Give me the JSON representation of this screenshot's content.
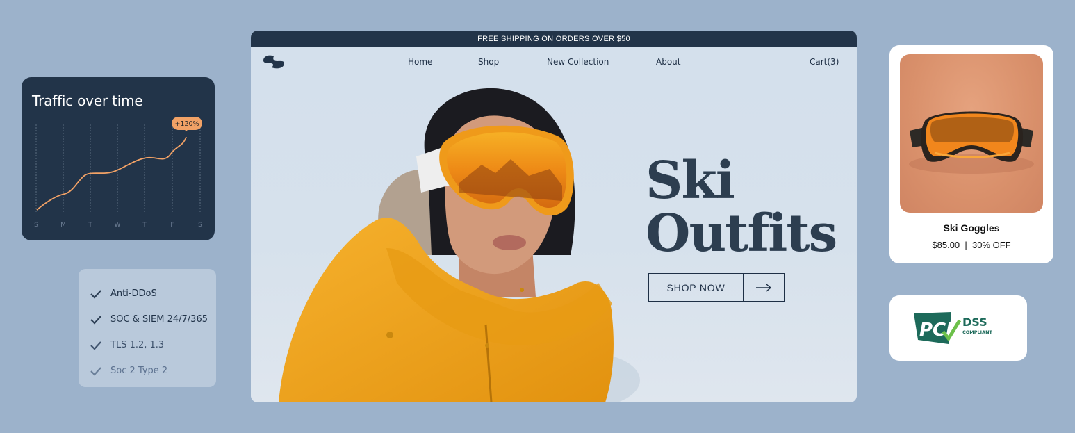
{
  "traffic": {
    "title": "Traffic over time",
    "badge": "+120%",
    "days": [
      "S",
      "M",
      "T",
      "W",
      "T",
      "F",
      "S"
    ]
  },
  "security": {
    "items": [
      "Anti-DDoS",
      "SOC & SIEM 24/7/365",
      "TLS 1.2, 1.3",
      "Soc 2 Type 2"
    ]
  },
  "store": {
    "announcement": "FREE SHIPPING ON ORDERS OVER $50",
    "nav": {
      "home": "Home",
      "shop": "Shop",
      "new_collection": "New Collection",
      "about": "About",
      "cart": "Cart(3)"
    },
    "headline_line1": "Ski",
    "headline_line2": "Outfits",
    "cta": "SHOP NOW"
  },
  "product": {
    "name": "Ski Goggles",
    "price_line": "$85.00  |  30% OFF"
  },
  "pci": {
    "brand": "PCI",
    "dss": "DSS",
    "compliant": "COMPLIANT"
  },
  "colors": {
    "background": "#9cb2cb",
    "navy": "#223449",
    "accent_orange": "#f2a266",
    "jacket_yellow": "#f0a41c",
    "pci_green": "#1d6a5a"
  }
}
